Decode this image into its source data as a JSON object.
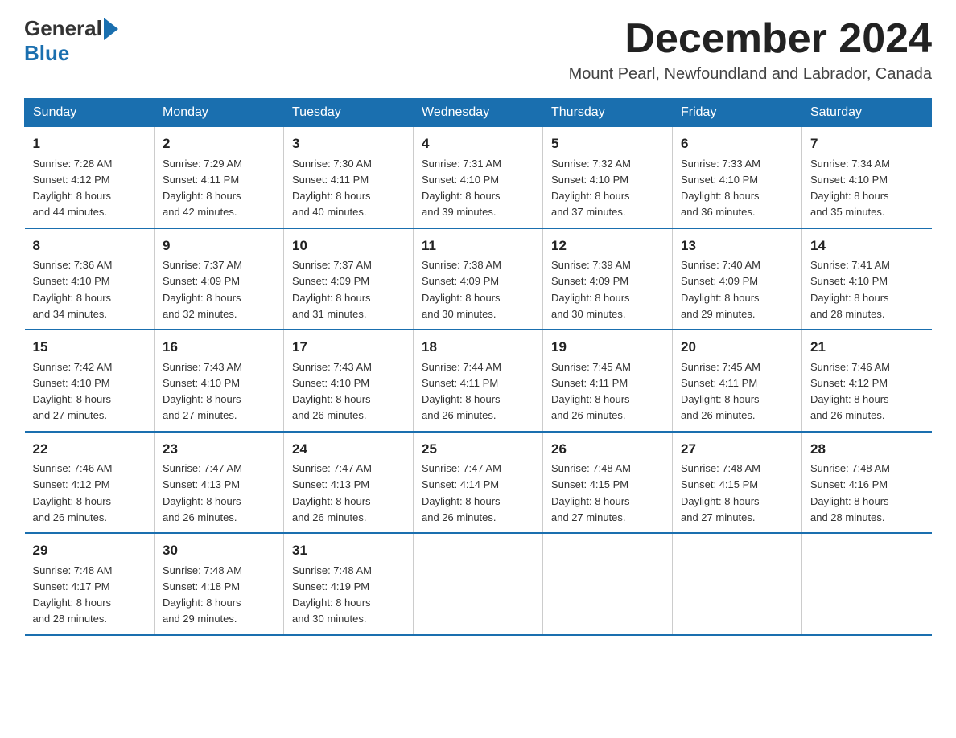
{
  "logo": {
    "general": "General",
    "blue": "Blue"
  },
  "title": "December 2024",
  "location": "Mount Pearl, Newfoundland and Labrador, Canada",
  "days_of_week": [
    "Sunday",
    "Monday",
    "Tuesday",
    "Wednesday",
    "Thursday",
    "Friday",
    "Saturday"
  ],
  "weeks": [
    [
      {
        "day": "1",
        "sunrise": "7:28 AM",
        "sunset": "4:12 PM",
        "daylight": "8 hours and 44 minutes."
      },
      {
        "day": "2",
        "sunrise": "7:29 AM",
        "sunset": "4:11 PM",
        "daylight": "8 hours and 42 minutes."
      },
      {
        "day": "3",
        "sunrise": "7:30 AM",
        "sunset": "4:11 PM",
        "daylight": "8 hours and 40 minutes."
      },
      {
        "day": "4",
        "sunrise": "7:31 AM",
        "sunset": "4:10 PM",
        "daylight": "8 hours and 39 minutes."
      },
      {
        "day": "5",
        "sunrise": "7:32 AM",
        "sunset": "4:10 PM",
        "daylight": "8 hours and 37 minutes."
      },
      {
        "day": "6",
        "sunrise": "7:33 AM",
        "sunset": "4:10 PM",
        "daylight": "8 hours and 36 minutes."
      },
      {
        "day": "7",
        "sunrise": "7:34 AM",
        "sunset": "4:10 PM",
        "daylight": "8 hours and 35 minutes."
      }
    ],
    [
      {
        "day": "8",
        "sunrise": "7:36 AM",
        "sunset": "4:10 PM",
        "daylight": "8 hours and 34 minutes."
      },
      {
        "day": "9",
        "sunrise": "7:37 AM",
        "sunset": "4:09 PM",
        "daylight": "8 hours and 32 minutes."
      },
      {
        "day": "10",
        "sunrise": "7:37 AM",
        "sunset": "4:09 PM",
        "daylight": "8 hours and 31 minutes."
      },
      {
        "day": "11",
        "sunrise": "7:38 AM",
        "sunset": "4:09 PM",
        "daylight": "8 hours and 30 minutes."
      },
      {
        "day": "12",
        "sunrise": "7:39 AM",
        "sunset": "4:09 PM",
        "daylight": "8 hours and 30 minutes."
      },
      {
        "day": "13",
        "sunrise": "7:40 AM",
        "sunset": "4:09 PM",
        "daylight": "8 hours and 29 minutes."
      },
      {
        "day": "14",
        "sunrise": "7:41 AM",
        "sunset": "4:10 PM",
        "daylight": "8 hours and 28 minutes."
      }
    ],
    [
      {
        "day": "15",
        "sunrise": "7:42 AM",
        "sunset": "4:10 PM",
        "daylight": "8 hours and 27 minutes."
      },
      {
        "day": "16",
        "sunrise": "7:43 AM",
        "sunset": "4:10 PM",
        "daylight": "8 hours and 27 minutes."
      },
      {
        "day": "17",
        "sunrise": "7:43 AM",
        "sunset": "4:10 PM",
        "daylight": "8 hours and 26 minutes."
      },
      {
        "day": "18",
        "sunrise": "7:44 AM",
        "sunset": "4:11 PM",
        "daylight": "8 hours and 26 minutes."
      },
      {
        "day": "19",
        "sunrise": "7:45 AM",
        "sunset": "4:11 PM",
        "daylight": "8 hours and 26 minutes."
      },
      {
        "day": "20",
        "sunrise": "7:45 AM",
        "sunset": "4:11 PM",
        "daylight": "8 hours and 26 minutes."
      },
      {
        "day": "21",
        "sunrise": "7:46 AM",
        "sunset": "4:12 PM",
        "daylight": "8 hours and 26 minutes."
      }
    ],
    [
      {
        "day": "22",
        "sunrise": "7:46 AM",
        "sunset": "4:12 PM",
        "daylight": "8 hours and 26 minutes."
      },
      {
        "day": "23",
        "sunrise": "7:47 AM",
        "sunset": "4:13 PM",
        "daylight": "8 hours and 26 minutes."
      },
      {
        "day": "24",
        "sunrise": "7:47 AM",
        "sunset": "4:13 PM",
        "daylight": "8 hours and 26 minutes."
      },
      {
        "day": "25",
        "sunrise": "7:47 AM",
        "sunset": "4:14 PM",
        "daylight": "8 hours and 26 minutes."
      },
      {
        "day": "26",
        "sunrise": "7:48 AM",
        "sunset": "4:15 PM",
        "daylight": "8 hours and 27 minutes."
      },
      {
        "day": "27",
        "sunrise": "7:48 AM",
        "sunset": "4:15 PM",
        "daylight": "8 hours and 27 minutes."
      },
      {
        "day": "28",
        "sunrise": "7:48 AM",
        "sunset": "4:16 PM",
        "daylight": "8 hours and 28 minutes."
      }
    ],
    [
      {
        "day": "29",
        "sunrise": "7:48 AM",
        "sunset": "4:17 PM",
        "daylight": "8 hours and 28 minutes."
      },
      {
        "day": "30",
        "sunrise": "7:48 AM",
        "sunset": "4:18 PM",
        "daylight": "8 hours and 29 minutes."
      },
      {
        "day": "31",
        "sunrise": "7:48 AM",
        "sunset": "4:19 PM",
        "daylight": "8 hours and 30 minutes."
      },
      null,
      null,
      null,
      null
    ]
  ],
  "labels": {
    "sunrise": "Sunrise:",
    "sunset": "Sunset:",
    "daylight": "Daylight:"
  }
}
